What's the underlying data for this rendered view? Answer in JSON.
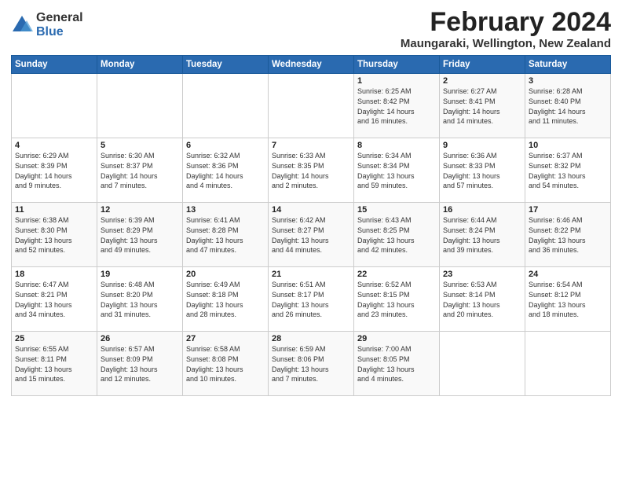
{
  "logo": {
    "general": "General",
    "blue": "Blue"
  },
  "title": "February 2024",
  "subtitle": "Maungaraki, Wellington, New Zealand",
  "days_header": [
    "Sunday",
    "Monday",
    "Tuesday",
    "Wednesday",
    "Thursday",
    "Friday",
    "Saturday"
  ],
  "weeks": [
    [
      {
        "day": "",
        "info": ""
      },
      {
        "day": "",
        "info": ""
      },
      {
        "day": "",
        "info": ""
      },
      {
        "day": "",
        "info": ""
      },
      {
        "day": "1",
        "info": "Sunrise: 6:25 AM\nSunset: 8:42 PM\nDaylight: 14 hours\nand 16 minutes."
      },
      {
        "day": "2",
        "info": "Sunrise: 6:27 AM\nSunset: 8:41 PM\nDaylight: 14 hours\nand 14 minutes."
      },
      {
        "day": "3",
        "info": "Sunrise: 6:28 AM\nSunset: 8:40 PM\nDaylight: 14 hours\nand 11 minutes."
      }
    ],
    [
      {
        "day": "4",
        "info": "Sunrise: 6:29 AM\nSunset: 8:39 PM\nDaylight: 14 hours\nand 9 minutes."
      },
      {
        "day": "5",
        "info": "Sunrise: 6:30 AM\nSunset: 8:37 PM\nDaylight: 14 hours\nand 7 minutes."
      },
      {
        "day": "6",
        "info": "Sunrise: 6:32 AM\nSunset: 8:36 PM\nDaylight: 14 hours\nand 4 minutes."
      },
      {
        "day": "7",
        "info": "Sunrise: 6:33 AM\nSunset: 8:35 PM\nDaylight: 14 hours\nand 2 minutes."
      },
      {
        "day": "8",
        "info": "Sunrise: 6:34 AM\nSunset: 8:34 PM\nDaylight: 13 hours\nand 59 minutes."
      },
      {
        "day": "9",
        "info": "Sunrise: 6:36 AM\nSunset: 8:33 PM\nDaylight: 13 hours\nand 57 minutes."
      },
      {
        "day": "10",
        "info": "Sunrise: 6:37 AM\nSunset: 8:32 PM\nDaylight: 13 hours\nand 54 minutes."
      }
    ],
    [
      {
        "day": "11",
        "info": "Sunrise: 6:38 AM\nSunset: 8:30 PM\nDaylight: 13 hours\nand 52 minutes."
      },
      {
        "day": "12",
        "info": "Sunrise: 6:39 AM\nSunset: 8:29 PM\nDaylight: 13 hours\nand 49 minutes."
      },
      {
        "day": "13",
        "info": "Sunrise: 6:41 AM\nSunset: 8:28 PM\nDaylight: 13 hours\nand 47 minutes."
      },
      {
        "day": "14",
        "info": "Sunrise: 6:42 AM\nSunset: 8:27 PM\nDaylight: 13 hours\nand 44 minutes."
      },
      {
        "day": "15",
        "info": "Sunrise: 6:43 AM\nSunset: 8:25 PM\nDaylight: 13 hours\nand 42 minutes."
      },
      {
        "day": "16",
        "info": "Sunrise: 6:44 AM\nSunset: 8:24 PM\nDaylight: 13 hours\nand 39 minutes."
      },
      {
        "day": "17",
        "info": "Sunrise: 6:46 AM\nSunset: 8:22 PM\nDaylight: 13 hours\nand 36 minutes."
      }
    ],
    [
      {
        "day": "18",
        "info": "Sunrise: 6:47 AM\nSunset: 8:21 PM\nDaylight: 13 hours\nand 34 minutes."
      },
      {
        "day": "19",
        "info": "Sunrise: 6:48 AM\nSunset: 8:20 PM\nDaylight: 13 hours\nand 31 minutes."
      },
      {
        "day": "20",
        "info": "Sunrise: 6:49 AM\nSunset: 8:18 PM\nDaylight: 13 hours\nand 28 minutes."
      },
      {
        "day": "21",
        "info": "Sunrise: 6:51 AM\nSunset: 8:17 PM\nDaylight: 13 hours\nand 26 minutes."
      },
      {
        "day": "22",
        "info": "Sunrise: 6:52 AM\nSunset: 8:15 PM\nDaylight: 13 hours\nand 23 minutes."
      },
      {
        "day": "23",
        "info": "Sunrise: 6:53 AM\nSunset: 8:14 PM\nDaylight: 13 hours\nand 20 minutes."
      },
      {
        "day": "24",
        "info": "Sunrise: 6:54 AM\nSunset: 8:12 PM\nDaylight: 13 hours\nand 18 minutes."
      }
    ],
    [
      {
        "day": "25",
        "info": "Sunrise: 6:55 AM\nSunset: 8:11 PM\nDaylight: 13 hours\nand 15 minutes."
      },
      {
        "day": "26",
        "info": "Sunrise: 6:57 AM\nSunset: 8:09 PM\nDaylight: 13 hours\nand 12 minutes."
      },
      {
        "day": "27",
        "info": "Sunrise: 6:58 AM\nSunset: 8:08 PM\nDaylight: 13 hours\nand 10 minutes."
      },
      {
        "day": "28",
        "info": "Sunrise: 6:59 AM\nSunset: 8:06 PM\nDaylight: 13 hours\nand 7 minutes."
      },
      {
        "day": "29",
        "info": "Sunrise: 7:00 AM\nSunset: 8:05 PM\nDaylight: 13 hours\nand 4 minutes."
      },
      {
        "day": "",
        "info": ""
      },
      {
        "day": "",
        "info": ""
      }
    ]
  ]
}
